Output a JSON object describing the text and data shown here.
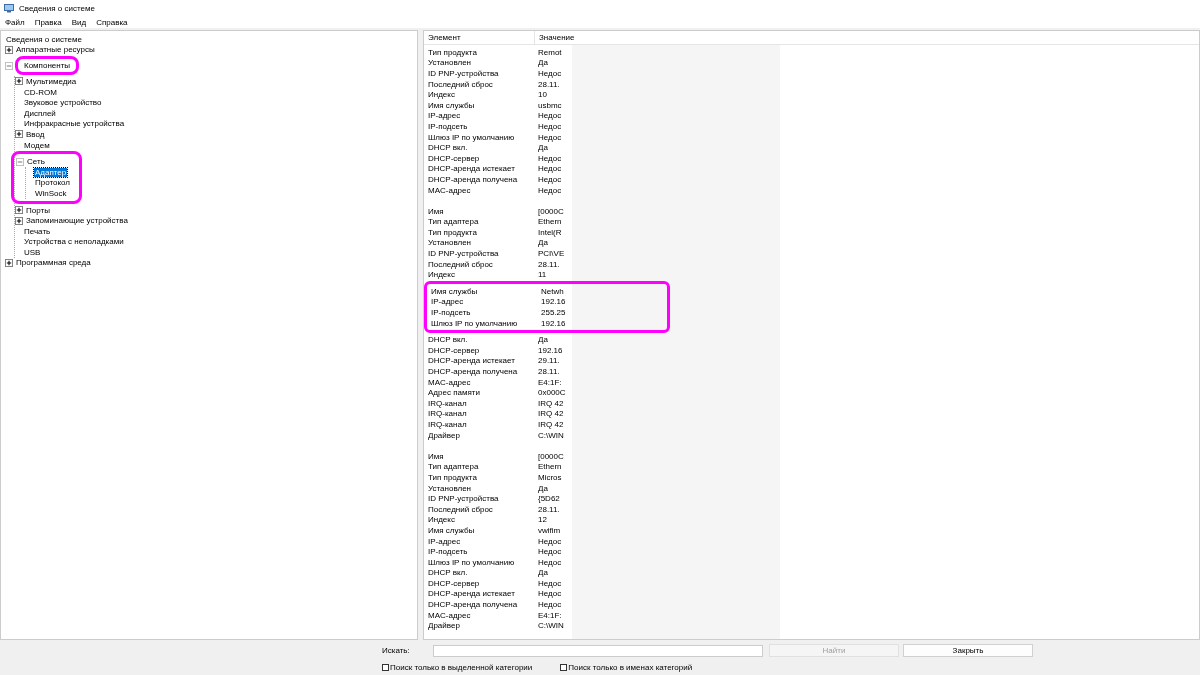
{
  "window": {
    "title": "Сведения о системе"
  },
  "menu": [
    "Файл",
    "Правка",
    "Вид",
    "Справка"
  ],
  "tree": {
    "label": "Сведения о системе",
    "children": [
      {
        "label": "Аппаратные ресурсы",
        "expanded": false,
        "highlighted": false,
        "selected": false
      },
      {
        "label": "Компоненты",
        "expanded": true,
        "highlighted": true,
        "selected": false,
        "children": [
          {
            "label": "Мультимедиа",
            "expanded": false,
            "highlighted": false,
            "selected": false
          },
          {
            "label": "CD-ROM",
            "highlighted": false,
            "selected": false
          },
          {
            "label": "Звуковое устройство",
            "highlighted": false,
            "selected": false
          },
          {
            "label": "Дисплей",
            "highlighted": false,
            "selected": false
          },
          {
            "label": "Инфракрасные устройства",
            "highlighted": false,
            "selected": false
          },
          {
            "label": "Ввод",
            "expanded": false,
            "highlighted": false,
            "selected": false
          },
          {
            "label": "Модем",
            "highlighted": false,
            "selected": false
          },
          {
            "label": "Сеть",
            "expanded": true,
            "highlighted": true,
            "selected": false,
            "children": [
              {
                "label": "Адаптер",
                "highlighted": false,
                "selected": true
              },
              {
                "label": "Протокол",
                "highlighted": false,
                "selected": false
              },
              {
                "label": "WinSock",
                "highlighted": false,
                "selected": false
              }
            ]
          },
          {
            "label": "Порты",
            "expanded": false,
            "highlighted": false,
            "selected": false
          },
          {
            "label": "Запоминающие устройства",
            "expanded": false,
            "highlighted": false,
            "selected": false
          },
          {
            "label": "Печать",
            "highlighted": false,
            "selected": false
          },
          {
            "label": "Устройства с неполадками",
            "highlighted": false,
            "selected": false
          },
          {
            "label": "USB",
            "highlighted": false,
            "selected": false
          }
        ]
      },
      {
        "label": "Программная среда",
        "expanded": false,
        "highlighted": false,
        "selected": false
      }
    ]
  },
  "table": {
    "columns": [
      "Элемент",
      "Значение"
    ],
    "groups": [
      {
        "rows": [
          {
            "item": "Тип продукта",
            "value": "Remot",
            "highlighted": false
          },
          {
            "item": "Установлен",
            "value": "Да",
            "highlighted": false
          },
          {
            "item": "ID PNP-устройства",
            "value": "Недос",
            "highlighted": false
          },
          {
            "item": "Последний сброс",
            "value": "28.11.",
            "highlighted": false
          },
          {
            "item": "Индекс",
            "value": "10",
            "highlighted": false
          },
          {
            "item": "Имя службы",
            "value": "usbmc",
            "highlighted": false
          },
          {
            "item": "IP-адрес",
            "value": "Недос",
            "highlighted": false
          },
          {
            "item": "IP-подсеть",
            "value": "Недос",
            "highlighted": false
          },
          {
            "item": "Шлюз IP по умолчанию",
            "value": "Недос",
            "highlighted": false
          },
          {
            "item": "DHCP вкл.",
            "value": "Да",
            "highlighted": false
          },
          {
            "item": "DHCP-сервер",
            "value": "Недос",
            "highlighted": false
          },
          {
            "item": "DHCP-аренда истекает",
            "value": "Недос",
            "highlighted": false
          },
          {
            "item": "DHCP-аренда получена",
            "value": "Недос",
            "highlighted": false
          },
          {
            "item": "MAC-адрес",
            "value": "Недос",
            "highlighted": false
          }
        ]
      },
      {
        "rows": [
          {
            "item": "Имя",
            "value": "[0000C",
            "highlighted": false
          },
          {
            "item": "Тип адаптера",
            "value": "Ethern",
            "highlighted": false
          },
          {
            "item": "Тип продукта",
            "value": "Intel(R",
            "highlighted": false
          },
          {
            "item": "Установлен",
            "value": "Да",
            "highlighted": false
          },
          {
            "item": "ID PNP-устройства",
            "value": "PCI\\VE",
            "highlighted": false
          },
          {
            "item": "Последний сброс",
            "value": "28.11.",
            "highlighted": false
          },
          {
            "item": "Индекс",
            "value": "11",
            "highlighted": false
          },
          {
            "item": "Имя службы",
            "value": "Netwh",
            "highlighted": true
          },
          {
            "item": "IP-адрес",
            "value": "192.16",
            "highlighted": true
          },
          {
            "item": "IP-подсеть",
            "value": "255.25",
            "highlighted": true
          },
          {
            "item": "Шлюз IP по умолчанию",
            "value": "192.16",
            "highlighted": true
          },
          {
            "item": "DHCP вкл.",
            "value": "Да",
            "highlighted": false
          },
          {
            "item": "DHCP-сервер",
            "value": "192.16",
            "highlighted": false
          },
          {
            "item": "DHCP-аренда истекает",
            "value": "29.11.",
            "highlighted": false
          },
          {
            "item": "DHCP-аренда получена",
            "value": "28.11.",
            "highlighted": false
          },
          {
            "item": "MAC-адрес",
            "value": "E4:1F:",
            "highlighted": false
          },
          {
            "item": "Адрес памяти",
            "value": "0x000C",
            "highlighted": false
          },
          {
            "item": "IRQ-канал",
            "value": "IRQ 42",
            "highlighted": false
          },
          {
            "item": "IRQ-канал",
            "value": "IRQ 42",
            "highlighted": false
          },
          {
            "item": "IRQ-канал",
            "value": "IRQ 42",
            "highlighted": false
          },
          {
            "item": "Драйвер",
            "value": "C:\\WIN",
            "highlighted": false
          }
        ]
      },
      {
        "rows": [
          {
            "item": "Имя",
            "value": "[0000C",
            "highlighted": false
          },
          {
            "item": "Тип адаптера",
            "value": "Ethern",
            "highlighted": false
          },
          {
            "item": "Тип продукта",
            "value": "Micros",
            "highlighted": false
          },
          {
            "item": "Установлен",
            "value": "Да",
            "highlighted": false
          },
          {
            "item": "ID PNP-устройства",
            "value": "{5D62",
            "highlighted": false
          },
          {
            "item": "Последний сброс",
            "value": "28.11.",
            "highlighted": false
          },
          {
            "item": "Индекс",
            "value": "12",
            "highlighted": false
          },
          {
            "item": "Имя службы",
            "value": "vwifim",
            "highlighted": false
          },
          {
            "item": "IP-адрес",
            "value": "Недос",
            "highlighted": false
          },
          {
            "item": "IP-подсеть",
            "value": "Недос",
            "highlighted": false
          },
          {
            "item": "Шлюз IP по умолчанию",
            "value": "Недос",
            "highlighted": false
          },
          {
            "item": "DHCP вкл.",
            "value": "Да",
            "highlighted": false
          },
          {
            "item": "DHCP-сервер",
            "value": "Недос",
            "highlighted": false
          },
          {
            "item": "DHCP-аренда истекает",
            "value": "Недос",
            "highlighted": false
          },
          {
            "item": "DHCP-аренда получена",
            "value": "Недос",
            "highlighted": false
          },
          {
            "item": "MAC-адрес",
            "value": "E4:1F:",
            "highlighted": false
          },
          {
            "item": "Драйвер",
            "value": "C:\\WIN",
            "highlighted": false
          }
        ]
      }
    ]
  },
  "search": {
    "label": "Искать:",
    "find_button": {
      "label": "Найти",
      "disabled": true
    },
    "close_button": {
      "label": "Закрыть",
      "disabled": false
    },
    "options": [
      {
        "label": "Поиск только в выделенной категории",
        "checked": false
      },
      {
        "label": "Поиск только в именах категорий",
        "checked": false
      }
    ]
  }
}
